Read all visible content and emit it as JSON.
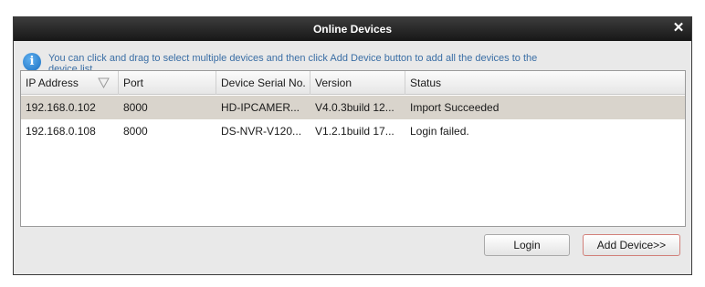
{
  "dialog": {
    "title": "Online Devices",
    "close_glyph": "✕",
    "info_icon": "info-icon",
    "info_message": "You can click and drag to select multiple devices and then click Add Device button to add all the devices to the device list."
  },
  "table": {
    "columns": [
      "IP Address",
      "Port",
      "Device Serial No.",
      "Version",
      "Status"
    ],
    "rows": [
      {
        "ip": "192.168.0.102",
        "port": "8000",
        "serial": "HD-IPCAMER...",
        "version": "V4.0.3build 12...",
        "status": "Import Succeeded",
        "selected": true
      },
      {
        "ip": "192.168.0.108",
        "port": "8000",
        "serial": "DS-NVR-V120...",
        "version": "V1.2.1build 17...",
        "status": "Login failed.",
        "selected": false
      }
    ]
  },
  "buttons": {
    "login": "Login",
    "add_device": "Add Device>>"
  },
  "colors": {
    "titlebar": "#1f1f1f",
    "info_text": "#3a6ea5",
    "selected_row": "#d9d4cc",
    "add_button_border": "#d2807a"
  }
}
